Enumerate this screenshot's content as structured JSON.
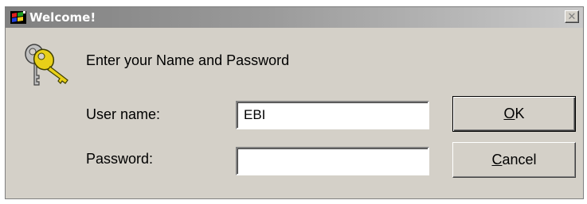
{
  "window": {
    "title": "Welcome!",
    "title_icon": "windows-flag-icon",
    "close_glyph": "✕"
  },
  "dialog": {
    "icon": "keys-icon",
    "prompt": "Enter your Name and Password"
  },
  "form": {
    "username_label": "User name:",
    "username_value": "EBI",
    "password_label": "Password:",
    "password_value": ""
  },
  "buttons": {
    "ok_label": "OK",
    "cancel_label": "Cancel"
  },
  "colors": {
    "dialog_bg": "#d4d0c8",
    "titlebar_inactive": "#808080",
    "field_bg": "#ffffff"
  }
}
